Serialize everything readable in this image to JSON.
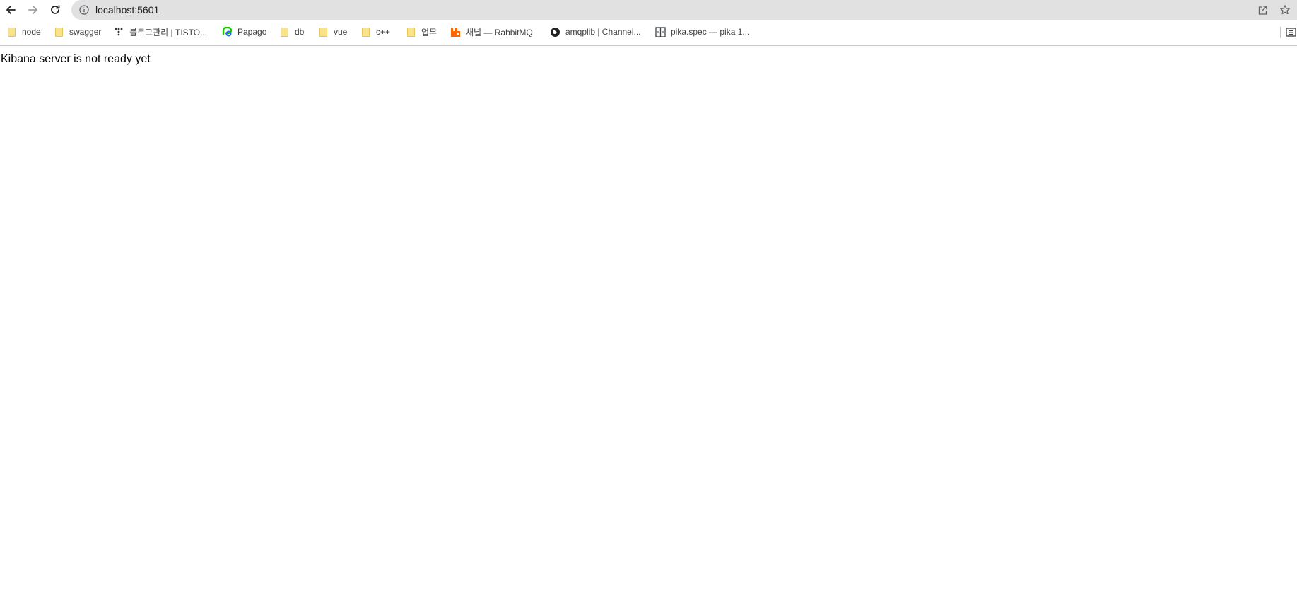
{
  "browser": {
    "url": "localhost:5601",
    "icons": {
      "back": "arrow-left-icon",
      "forward": "arrow-right-icon",
      "reload": "reload-icon",
      "site_info": "info-circle-icon",
      "share": "share-icon",
      "bookmark_star": "star-icon",
      "reading_list": "reading-list-icon"
    }
  },
  "bookmarks": [
    {
      "label": "node",
      "icon": "folder-icon"
    },
    {
      "label": "swagger",
      "icon": "folder-icon"
    },
    {
      "label": "블로그관리 | TISTO...",
      "icon": "tistory-icon"
    },
    {
      "label": "Papago",
      "icon": "papago-icon"
    },
    {
      "label": "db",
      "icon": "folder-icon"
    },
    {
      "label": "vue",
      "icon": "folder-icon"
    },
    {
      "label": "c++",
      "icon": "folder-icon"
    },
    {
      "label": "업무",
      "icon": "folder-icon"
    },
    {
      "label": "채널 — RabbitMQ",
      "icon": "rabbitmq-icon"
    },
    {
      "label": "amqplib | Channel...",
      "icon": "globe-icon"
    },
    {
      "label": "pika.spec — pika 1...",
      "icon": "document-icon"
    }
  ],
  "page": {
    "message": "Kibana server is not ready yet"
  },
  "colors": {
    "omnibox_bg": "#e1e1e1",
    "folder_fill": "#f8e38b",
    "rabbitmq": "#ff6600",
    "papago_green": "#1ec800",
    "papago_blue": "#1a73e8"
  }
}
